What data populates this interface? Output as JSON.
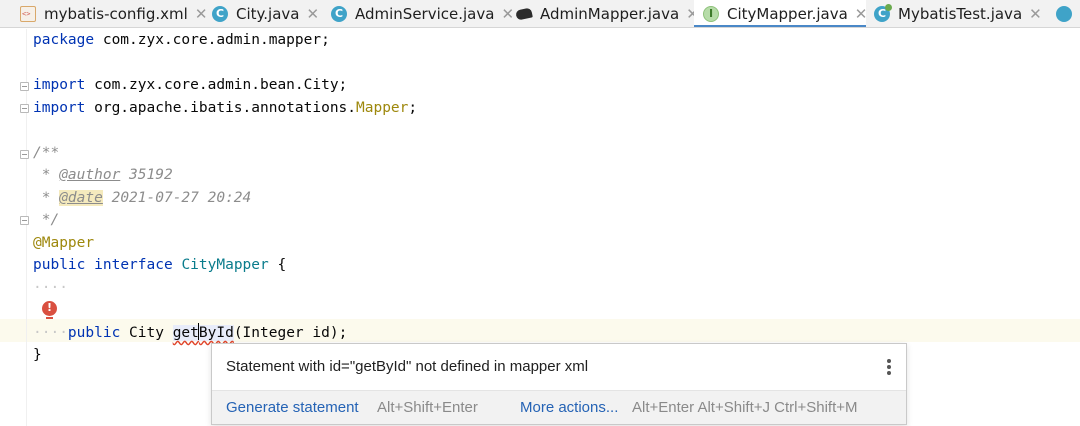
{
  "tabs": [
    {
      "label": "mybatis-config.xml",
      "icon": "xml-file-icon"
    },
    {
      "label": "City.java",
      "icon": "class-icon"
    },
    {
      "label": "AdminService.java",
      "icon": "class-icon"
    },
    {
      "label": "AdminMapper.java",
      "icon": "mybatis-bird-icon"
    },
    {
      "label": "CityMapper.java",
      "icon": "interface-icon",
      "active": true
    },
    {
      "label": "MybatisTest.java",
      "icon": "test-class-icon"
    }
  ],
  "close_glyph": "✕",
  "code": {
    "package_kw": "package",
    "package_name": " com.zyx.core.admin.mapper;",
    "import_kw": "import",
    "import1": " com.zyx.core.admin.bean.City;",
    "import2_prefix": " org.apache.ibatis.annotations.",
    "import2_class": "Mapper",
    "semicolon": ";",
    "doc_open": "/**",
    "doc_star": " * ",
    "author_tag": "@author",
    "author_val": " 35192",
    "date_tag": "@date",
    "date_val": " 2021-07-27 20:24",
    "doc_close": " */",
    "annotation": "@Mapper",
    "public_kw": "public",
    "interface_kw": "interface",
    "iface_name": "CityMapper",
    "brace_open": " {",
    "indent_dots": "····",
    "method_ret": " City ",
    "method_name_a": "get",
    "method_name_b": "ById",
    "method_params": "(Integer id);",
    "brace_close": "}"
  },
  "popup": {
    "message": "Statement with id=\"getById\" not defined in mapper xml",
    "action_primary": "Generate statement",
    "action_primary_shortcut": "Alt+Shift+Enter",
    "action_more": "More actions...",
    "action_more_shortcut": "Alt+Enter Alt+Shift+J Ctrl+Shift+M"
  },
  "colors": {
    "keyword": "#0033b3",
    "annotation": "#9e880d",
    "comment": "#8c8c8c",
    "link": "#2563b5",
    "tab_active_underline": "#4a88c7",
    "error": "#d95040"
  }
}
